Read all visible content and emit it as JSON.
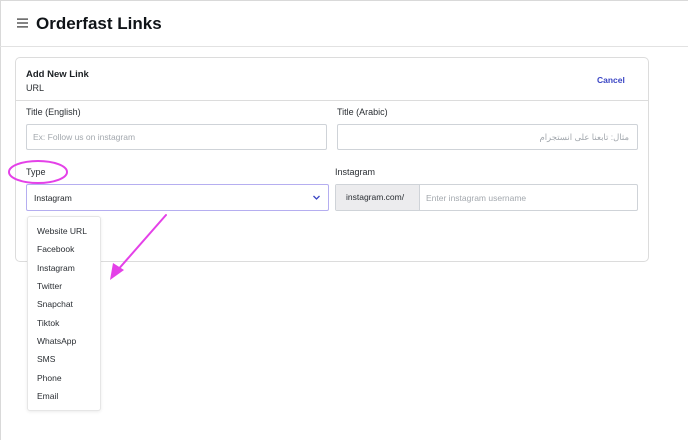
{
  "header": {
    "title": "Orderfast Links",
    "menu_icon": "hamburger-menu-icon"
  },
  "card": {
    "title": "Add New Link",
    "subtitle": "URL",
    "cancel_label": "Cancel"
  },
  "form": {
    "title_en": {
      "label": "Title (English)",
      "placeholder": "Ex: Follow us on instagram",
      "value": ""
    },
    "title_ar": {
      "label": "Title (Arabic)",
      "placeholder": "مثال: تابعنا على انستجرام",
      "value": ""
    },
    "type": {
      "label": "Type",
      "selected": "Instagram",
      "options": [
        "Website URL",
        "Facebook",
        "Instagram",
        "Twitter",
        "Snapchat",
        "Tiktok",
        "WhatsApp",
        "SMS",
        "Phone",
        "Email"
      ]
    },
    "instagram": {
      "label": "Instagram",
      "prefix": "instagram.com/",
      "placeholder": "Enter instagram username",
      "value": ""
    }
  },
  "colors": {
    "accent": "#3a45c4",
    "select_border": "#b5aef0",
    "annotation": "#e441e8"
  }
}
